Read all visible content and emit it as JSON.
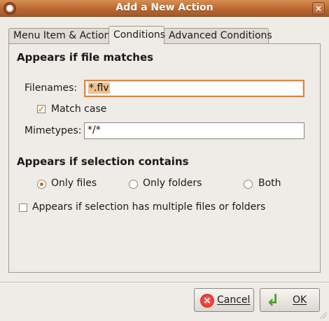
{
  "window": {
    "title": "Add a New Action",
    "close_icon": "×"
  },
  "tabs": [
    {
      "label": "Menu Item & Action",
      "active": false
    },
    {
      "label": "Conditions",
      "active": true
    },
    {
      "label": "Advanced Conditions",
      "active": false
    }
  ],
  "file_match": {
    "heading": "Appears if file matches",
    "filenames_label": "Filenames:",
    "filenames_value": "*.flv",
    "match_case_label": "Match case",
    "match_case_checked": true,
    "mimetypes_label": "Mimetypes:",
    "mimetypes_value": "*/*"
  },
  "selection": {
    "heading": "Appears if selection contains",
    "options": [
      {
        "label": "Only files",
        "selected": true
      },
      {
        "label": "Only folders",
        "selected": false
      },
      {
        "label": "Both",
        "selected": false
      }
    ],
    "multiple_label": "Appears if selection has multiple files or folders",
    "multiple_checked": false
  },
  "buttons": {
    "cancel_label": "Cancel",
    "ok_label": "OK"
  },
  "colors": {
    "titlebar": "#b9672f",
    "accent": "#d58b4a"
  }
}
